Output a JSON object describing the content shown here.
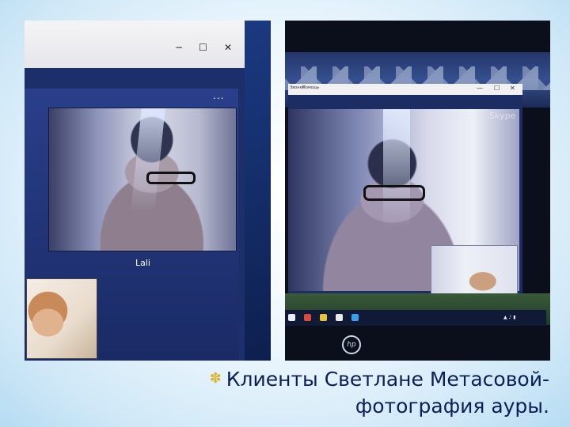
{
  "left_photo": {
    "window_controls": {
      "minimize": "−",
      "maximize": "☐",
      "close": "✕"
    },
    "more_menu": "...",
    "caller_name": "Lali"
  },
  "right_photo": {
    "menu_items": [
      "Звонки",
      "Помощь"
    ],
    "window_controls": {
      "minimize": "—",
      "maximize": "☐",
      "close": "✕"
    },
    "skype_logo": "Skype",
    "brand_logo": "hp"
  },
  "caption": {
    "line1": "Клиенты  Светлане Метасовой-",
    "line2": "фотография ауры."
  },
  "colors": {
    "caption_text": "#0c1e58",
    "bullet": "#d8b83c",
    "skype_window": "#1c2d63"
  },
  "icons": [
    "minimize-icon",
    "maximize-icon",
    "close-icon",
    "more-options-icon",
    "bullet-icon"
  ]
}
